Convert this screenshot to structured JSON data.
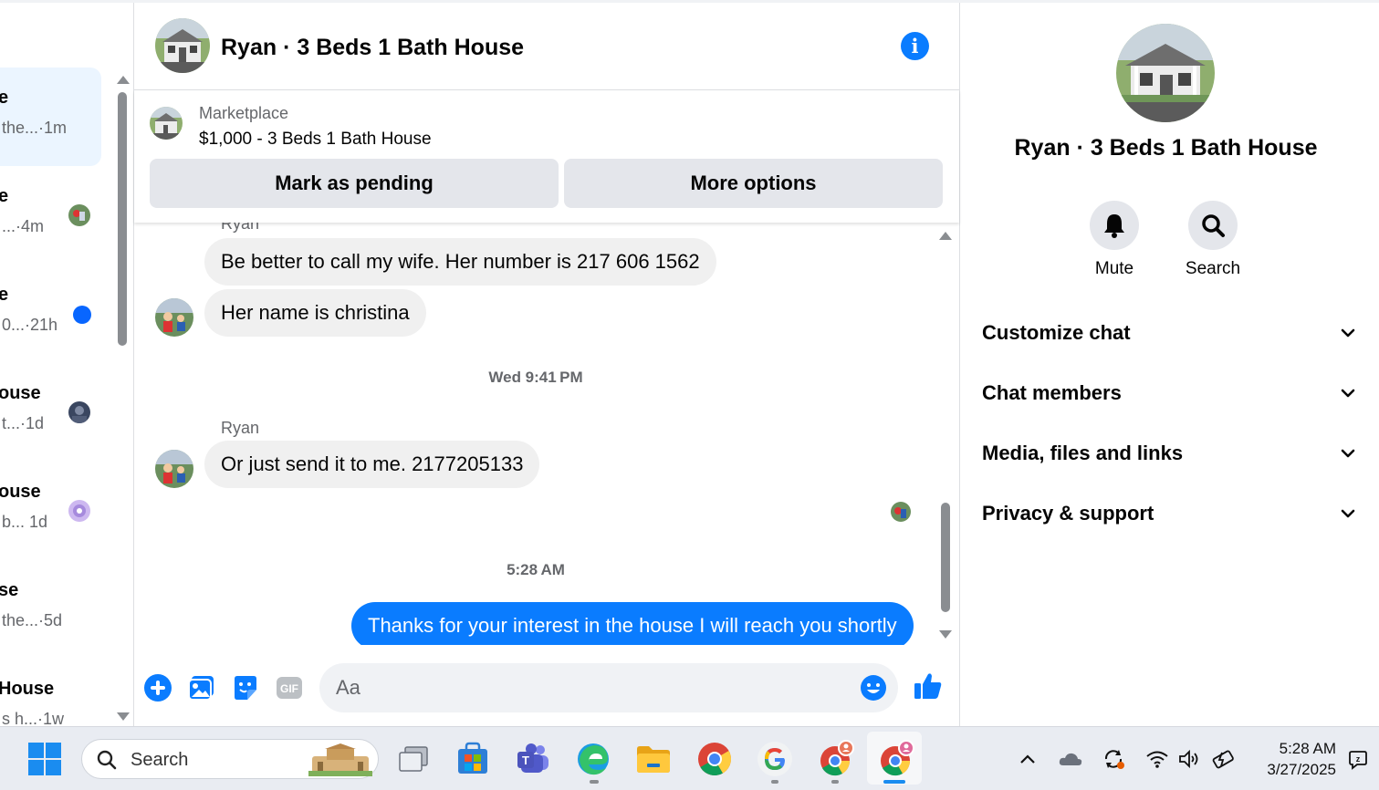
{
  "conversations": [
    {
      "name": "e",
      "preview": "the...",
      "time": "·1m",
      "active": true
    },
    {
      "name": "e",
      "preview": "...",
      "time": "·4m"
    },
    {
      "name": "e",
      "preview": "0...",
      "time": "·21h",
      "unread": true
    },
    {
      "name": "ouse",
      "preview": "t...",
      "time": "·1d"
    },
    {
      "name": "ouse",
      "preview": "b...",
      "time": "1d"
    },
    {
      "name": "se",
      "preview": "the...",
      "time": "·5d"
    },
    {
      "name": "House",
      "preview": "s h...",
      "time": "·1w"
    }
  ],
  "chat": {
    "title": "Ryan · 3 Beds 1 Bath House",
    "marketplace": {
      "label": "Marketplace",
      "listing": "$1,000 - 3 Beds 1 Bath House",
      "mark_pending": "Mark as pending",
      "more_options": "More options"
    },
    "messages": {
      "sender_top": "Ryan",
      "m1": "Be better to call my wife. Her number is 217 606 1562",
      "m2": "Her name is christina",
      "stamp1": "Wed 9:41 PM",
      "sender": "Ryan",
      "m3": "Or just send it to me. 2177205133",
      "stamp2": "5:28 AM",
      "m4": "Thanks for your interest in the house I will reach you shortly"
    },
    "composer": {
      "placeholder": "Aa"
    }
  },
  "details": {
    "title": "Ryan · 3 Beds 1 Bath House",
    "mute": "Mute",
    "search": "Search",
    "sections": [
      "Customize chat",
      "Chat members",
      "Media, files and links",
      "Privacy & support"
    ]
  },
  "taskbar": {
    "search_label": "Search",
    "time": "5:28 AM",
    "date": "3/27/2025"
  },
  "colors": {
    "accent": "#0a7cff",
    "bubble_in": "#f0f0f0",
    "button_bg": "#e4e6eb",
    "active_conv": "#ebf5ff",
    "unread_dot": "#0866ff"
  }
}
